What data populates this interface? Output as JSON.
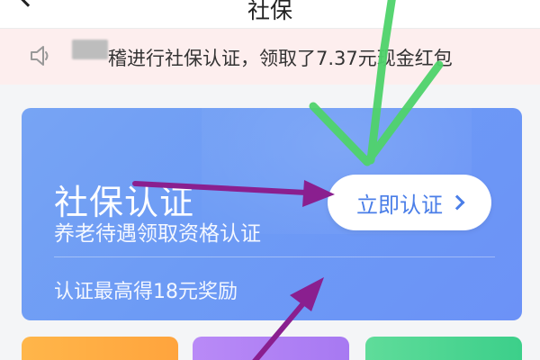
{
  "header": {
    "title": "社保"
  },
  "notice": {
    "text": "稽进行社保认证，领取了7.37元现金红包",
    "icon": "speaker-icon"
  },
  "card": {
    "title": "社保认证",
    "subtitle": "养老待遇领取资格认证",
    "cta_label": "立即认证",
    "reward_text": "认证最高得18元奖励"
  },
  "colors": {
    "card_blue": "#6d9bf5",
    "cta_text": "#4a7ee8",
    "notice_bg": "#fdeeee",
    "arrow_green": "#4fd36b",
    "arrow_purple": "#8a1f8f"
  }
}
